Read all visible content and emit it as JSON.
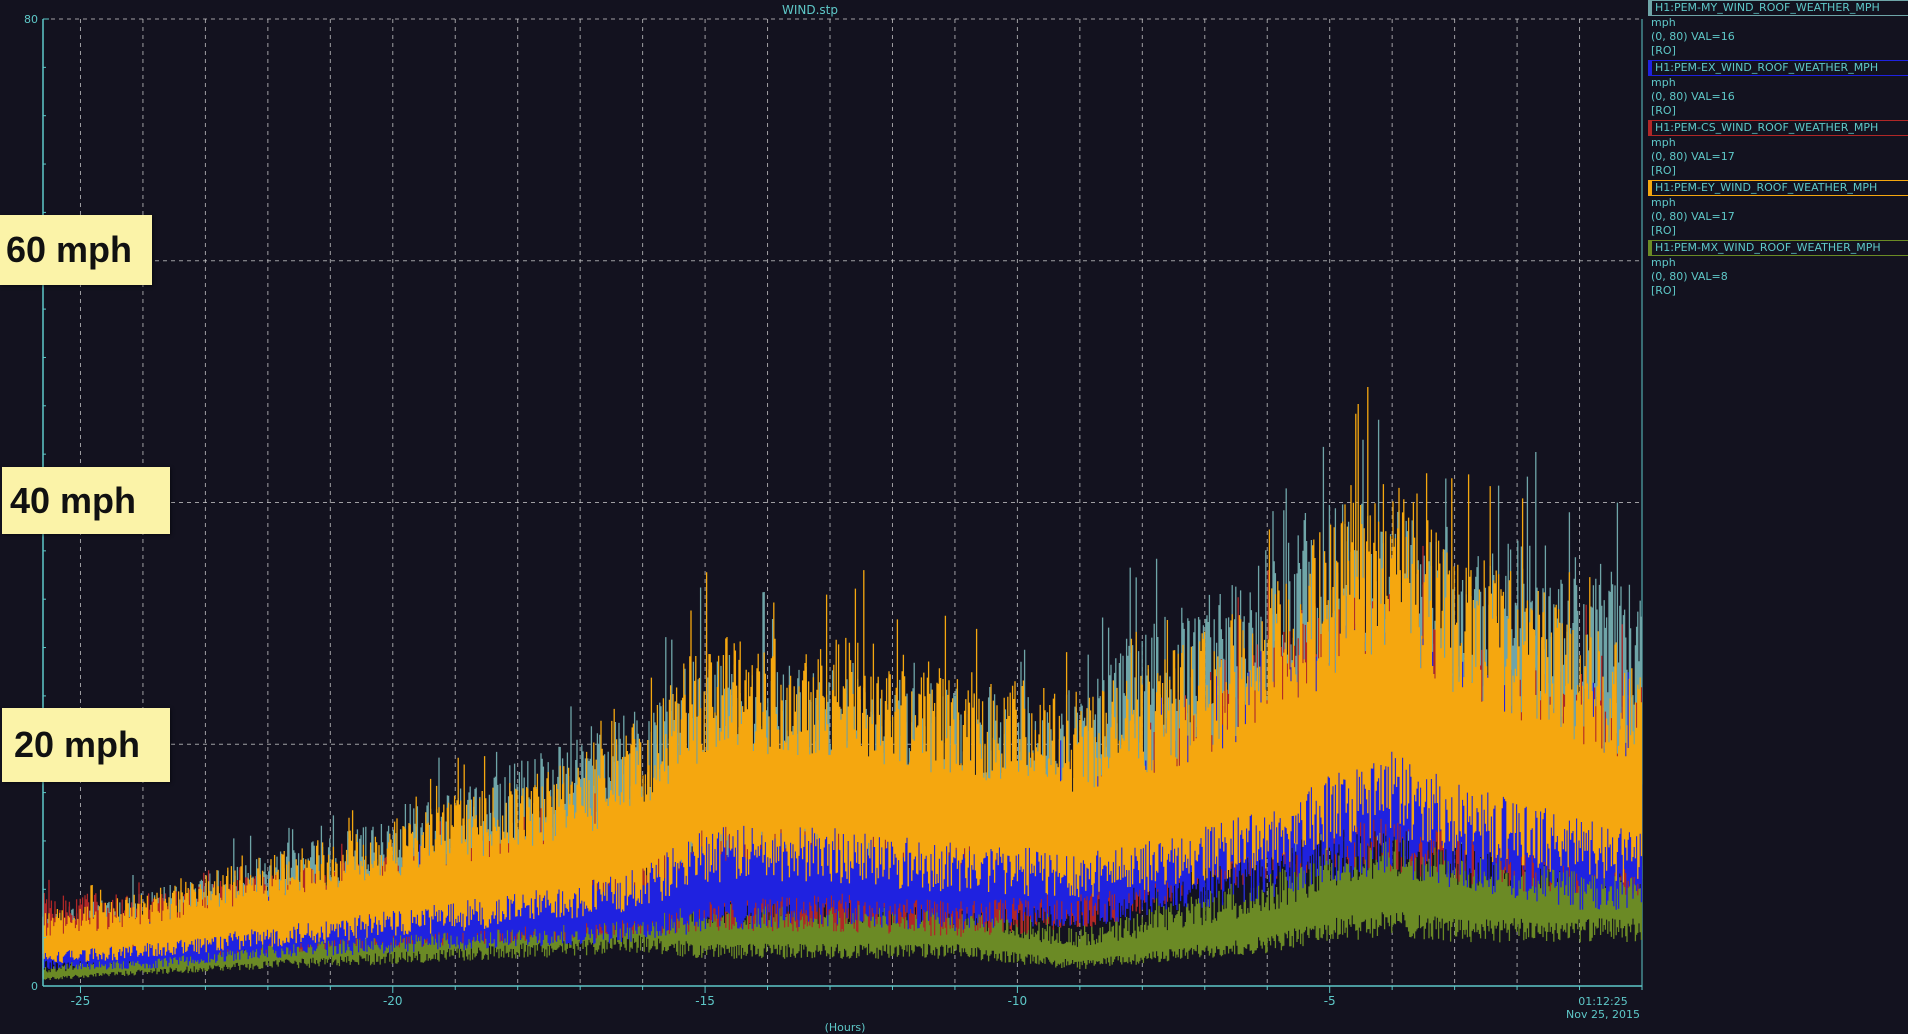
{
  "window": {
    "title": "WIND.stp"
  },
  "colors": {
    "background": "#13121f",
    "axis": "#5ec8c8",
    "grid": "#cfcfcf"
  },
  "callouts": [
    "60 mph",
    "40 mph",
    "20 mph"
  ],
  "legend": [
    {
      "channel": "H1:PEM-MY_WIND_ROOF_WEATHER_MPH",
      "unit": "mph",
      "range": "(0, 80) VAL=16",
      "mode": "[RO]",
      "color": "#6fa5a8"
    },
    {
      "channel": "H1:PEM-EX_WIND_ROOF_WEATHER_MPH",
      "unit": "mph",
      "range": "(0, 80) VAL=16",
      "mode": "[RO]",
      "color": "#1f22e0"
    },
    {
      "channel": "H1:PEM-CS_WIND_ROOF_WEATHER_MPH",
      "unit": "mph",
      "range": "(0, 80) VAL=17",
      "mode": "[RO]",
      "color": "#b02727"
    },
    {
      "channel": "H1:PEM-EY_WIND_ROOF_WEATHER_MPH",
      "unit": "mph",
      "range": "(0, 80) VAL=17",
      "mode": "[RO]",
      "color": "#f5a70f"
    },
    {
      "channel": "H1:PEM-MX_WIND_ROOF_WEATHER_MPH",
      "unit": "mph",
      "range": "(0, 80) VAL=8",
      "mode": "[RO]",
      "color": "#6b8a25"
    }
  ],
  "chart_data": {
    "type": "line",
    "title": "WIND.stp",
    "xlabel": "(Hours)",
    "ylabel": "",
    "xlim": [
      -25.6,
      0
    ],
    "ylim": [
      0,
      80
    ],
    "x_ticks": [
      -25,
      -20,
      -15,
      -10,
      -5
    ],
    "y_tick_labels": [
      "0",
      "80"
    ],
    "end_time": "01:12:25",
    "end_date": "Nov 25, 2015",
    "grid": true,
    "series": [
      {
        "name": "H1:PEM-MY_WIND_ROOF_WEATHER_MPH",
        "color": "#6fa5a8",
        "x": [
          -25.6,
          -24,
          -22,
          -20,
          -18,
          -16,
          -15,
          -13,
          -11,
          -9,
          -8,
          -7,
          -6,
          -5,
          -4,
          -3,
          -2,
          -1,
          0
        ],
        "y": [
          4,
          5,
          7,
          9,
          12,
          15,
          18,
          17,
          16,
          16,
          19,
          21,
          23,
          26,
          26,
          25,
          24,
          23,
          22
        ]
      },
      {
        "name": "H1:PEM-EX_WIND_ROOF_WEATHER_MPH",
        "color": "#1f22e0",
        "x": [
          -25.6,
          -24,
          -22,
          -20,
          -18,
          -16,
          -15,
          -13,
          -11,
          -9,
          -8,
          -7,
          -6,
          -5,
          -4,
          -3,
          -2,
          -1,
          0
        ],
        "y": [
          3,
          3,
          5,
          6,
          7,
          8,
          10,
          11,
          10,
          11,
          12,
          14,
          16,
          19,
          20,
          18,
          16,
          14,
          14
        ]
      },
      {
        "name": "H1:PEM-CS_WIND_ROOF_WEATHER_MPH",
        "color": "#b02727",
        "x": [
          -25.6,
          -24,
          -22,
          -20,
          -18,
          -16,
          -15,
          -13,
          -11,
          -9,
          -8,
          -7,
          -6,
          -5,
          -4,
          -3,
          -2,
          -1,
          0
        ],
        "y": [
          5,
          5,
          6,
          7,
          8,
          9,
          10,
          10,
          9,
          10,
          13,
          17,
          19,
          21,
          21,
          19,
          17,
          17,
          16
        ]
      },
      {
        "name": "H1:PEM-EY_WIND_ROOF_WEATHER_MPH",
        "color": "#f5a70f",
        "x": [
          -25.6,
          -24,
          -22,
          -20,
          -18,
          -16,
          -15,
          -13,
          -11,
          -9,
          -8,
          -7,
          -6,
          -5,
          -4,
          -3,
          -2,
          -1,
          0
        ],
        "y": [
          4,
          5,
          7,
          9,
          11,
          14,
          19,
          19,
          17,
          16,
          17,
          19,
          21,
          25,
          28,
          24,
          22,
          20,
          18
        ]
      },
      {
        "name": "H1:PEM-MX_WIND_ROOF_WEATHER_MPH",
        "color": "#6b8a25",
        "x": [
          -25.6,
          -24,
          -22,
          -20,
          -18,
          -16,
          -15,
          -13,
          -11,
          -9,
          -8,
          -7,
          -6,
          -5,
          -4,
          -3,
          -2,
          -1,
          0
        ],
        "y": [
          1,
          2,
          3,
          4,
          5,
          6,
          5,
          5,
          5,
          3,
          4,
          5,
          6,
          8,
          9,
          8,
          8,
          8,
          8
        ]
      }
    ]
  }
}
